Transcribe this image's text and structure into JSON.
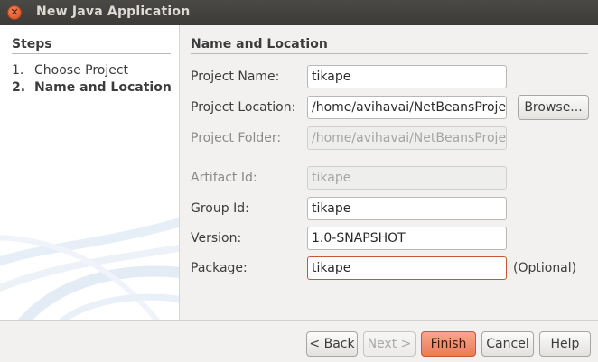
{
  "window": {
    "title": "New Java Application",
    "close_icon": "close-icon"
  },
  "steps": {
    "title": "Steps",
    "items": [
      {
        "num": "1.",
        "label": "Choose Project",
        "current": false
      },
      {
        "num": "2.",
        "label": "Name and Location",
        "current": true
      }
    ]
  },
  "section": {
    "title": "Name and Location"
  },
  "fields": {
    "project_name": {
      "label": "Project Name:",
      "value": "tikape"
    },
    "project_location": {
      "label": "Project Location:",
      "value": "/home/avihavai/NetBeansProjects"
    },
    "project_folder": {
      "label": "Project Folder:",
      "value": "/home/avihavai/NetBeansProjects/tikape"
    },
    "artifact_id": {
      "label": "Artifact Id:",
      "value": "tikape"
    },
    "group_id": {
      "label": "Group Id:",
      "value": "tikape"
    },
    "version": {
      "label": "Version:",
      "value": "1.0-SNAPSHOT"
    },
    "package": {
      "label": "Package:",
      "value": "tikape",
      "hint": "(Optional)"
    }
  },
  "buttons": {
    "browse": "Browse...",
    "back": "< Back",
    "next": "Next >",
    "finish": "Finish",
    "cancel": "Cancel",
    "help": "Help"
  },
  "colors": {
    "titlebar": "#3c3b37",
    "close_button": "#e25b2c",
    "finish_button": "#ec7b56",
    "error_border": "#c8553a"
  }
}
